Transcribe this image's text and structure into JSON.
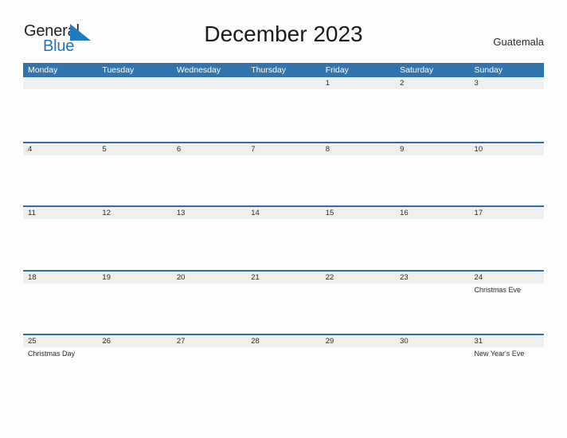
{
  "logo": {
    "word1": "General",
    "word2": "Blue",
    "triangle_color": "#1d7bc0",
    "word1_color": "#231f20",
    "word2_color": "#2374b5"
  },
  "header": {
    "title": "December 2023",
    "country": "Guatemala"
  },
  "theme": {
    "header_blue": "#3175b0",
    "row_rule_blue": "#2f6fa8",
    "daystrip_gray": "#efefef",
    "page_background": "#fdfdfd",
    "text_color": "#2b2b2b"
  },
  "calendar": {
    "day_headers": [
      "Monday",
      "Tuesday",
      "Wednesday",
      "Thursday",
      "Friday",
      "Saturday",
      "Sunday"
    ],
    "weeks": [
      {
        "days": [
          {
            "num": "",
            "event": ""
          },
          {
            "num": "",
            "event": ""
          },
          {
            "num": "",
            "event": ""
          },
          {
            "num": "",
            "event": ""
          },
          {
            "num": "1",
            "event": ""
          },
          {
            "num": "2",
            "event": ""
          },
          {
            "num": "3",
            "event": ""
          }
        ]
      },
      {
        "days": [
          {
            "num": "4",
            "event": ""
          },
          {
            "num": "5",
            "event": ""
          },
          {
            "num": "6",
            "event": ""
          },
          {
            "num": "7",
            "event": ""
          },
          {
            "num": "8",
            "event": ""
          },
          {
            "num": "9",
            "event": ""
          },
          {
            "num": "10",
            "event": ""
          }
        ]
      },
      {
        "days": [
          {
            "num": "11",
            "event": ""
          },
          {
            "num": "12",
            "event": ""
          },
          {
            "num": "13",
            "event": ""
          },
          {
            "num": "14",
            "event": ""
          },
          {
            "num": "15",
            "event": ""
          },
          {
            "num": "16",
            "event": ""
          },
          {
            "num": "17",
            "event": ""
          }
        ]
      },
      {
        "days": [
          {
            "num": "18",
            "event": ""
          },
          {
            "num": "19",
            "event": ""
          },
          {
            "num": "20",
            "event": ""
          },
          {
            "num": "21",
            "event": ""
          },
          {
            "num": "22",
            "event": ""
          },
          {
            "num": "23",
            "event": ""
          },
          {
            "num": "24",
            "event": "Christmas Eve"
          }
        ]
      },
      {
        "days": [
          {
            "num": "25",
            "event": "Christmas Day"
          },
          {
            "num": "26",
            "event": ""
          },
          {
            "num": "27",
            "event": ""
          },
          {
            "num": "28",
            "event": ""
          },
          {
            "num": "29",
            "event": ""
          },
          {
            "num": "30",
            "event": ""
          },
          {
            "num": "31",
            "event": "New Year's Eve"
          }
        ]
      }
    ]
  }
}
